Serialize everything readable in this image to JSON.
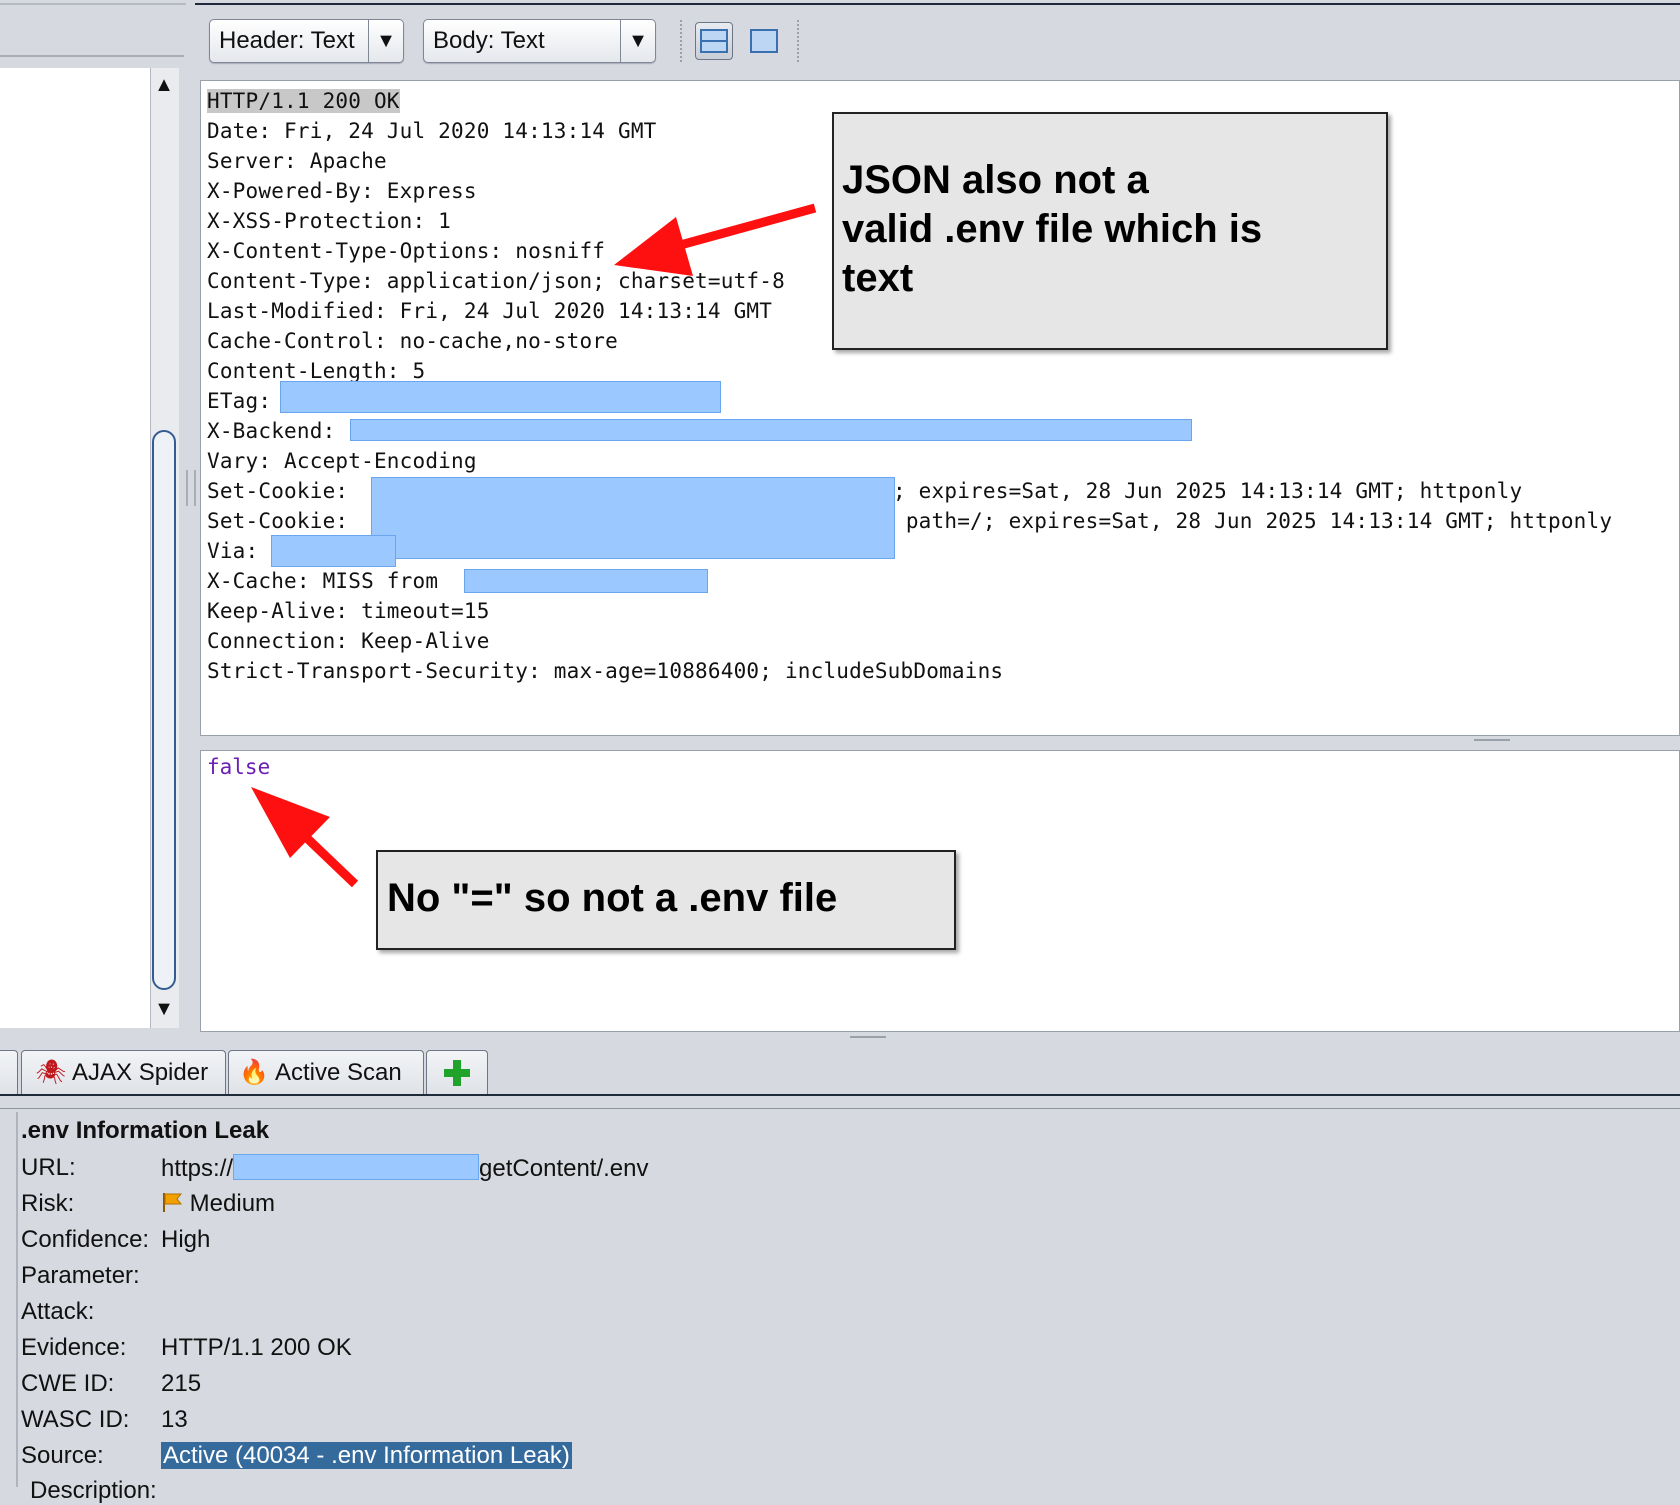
{
  "toolbar": {
    "header_view": "Header: Text",
    "body_view": "Body: Text"
  },
  "response_header": {
    "lines": [
      "HTTP/1.1 200 OK",
      "Date: Fri, 24 Jul 2020 14:13:14 GMT",
      "Server: Apache",
      "X-Powered-By: Express",
      "X-XSS-Protection: 1",
      "X-Content-Type-Options: nosniff",
      "Content-Type: application/json; charset=utf-8",
      "Last-Modified: Fri, 24 Jul 2020 14:13:14 GMT",
      "Cache-Control: no-cache,no-store",
      "Content-Length: 5",
      "ETag: ",
      "X-Backend: ",
      "Vary: Accept-Encoding",
      "Set-Cookie: ",
      "Set-Cookie: ",
      "Via: ",
      "X-Cache: MISS from ",
      "Keep-Alive: timeout=15",
      "Connection: Keep-Alive",
      "Strict-Transport-Security: max-age=10886400; includeSubDomains"
    ],
    "cookie1_suffix": "; expires=Sat, 28 Jun 2025 14:13:14 GMT; httponly",
    "cookie2_suffix": " path=/; expires=Sat, 28 Jun 2025 14:13:14 GMT; httponly"
  },
  "response_body": {
    "text": "false"
  },
  "annotations": {
    "json_callout": {
      "line1": "JSON also not a",
      "line2": "valid .env file which is",
      "line3": "text"
    },
    "env_callout": "No \"=\" so not a .env file",
    "arrow_color": "#ff0000"
  },
  "tabs": [
    {
      "label": "AJAX Spider",
      "icon": "spider-icon"
    },
    {
      "label": "Active Scan",
      "icon": "flame-icon"
    },
    {
      "label": "",
      "icon": "add-tab-icon"
    }
  ],
  "alert": {
    "title": ".env Information Leak",
    "fields": {
      "url_label": "URL:",
      "url_prefix": "https://",
      "url_suffix": "getContent/.env",
      "risk_label": "Risk:",
      "risk_value": "Medium",
      "risk_icon": "flag-icon",
      "confidence_label": "Confidence:",
      "confidence_value": "High",
      "parameter_label": "Parameter:",
      "attack_label": "Attack:",
      "evidence_label": "Evidence:",
      "evidence_value": "HTTP/1.1 200 OK",
      "cwe_label": "CWE ID:",
      "cwe_value": "215",
      "wasc_label": "WASC ID:",
      "wasc_value": "13",
      "source_label": "Source:",
      "source_value": "Active (40034 - .env Information Leak)",
      "description_label": "Description:"
    }
  }
}
